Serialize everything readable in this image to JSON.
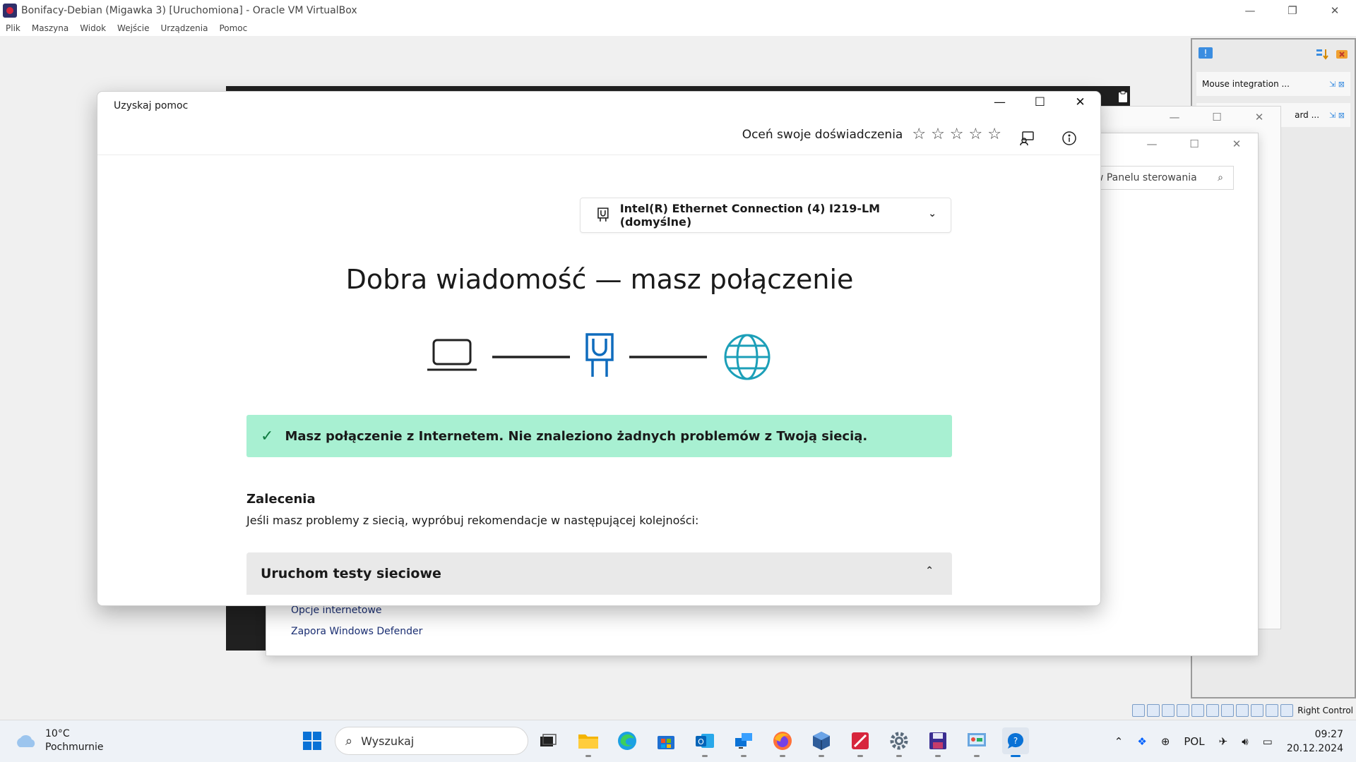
{
  "vbox": {
    "title": "Bonifacy-Debian (Migawka 3) [Uruchomiona] - Oracle VM VirtualBox",
    "menu": [
      "Plik",
      "Maszyna",
      "Widok",
      "Wejście",
      "Urządzenia",
      "Pomoc"
    ],
    "status_right": "Right Control"
  },
  "notifications": {
    "items": [
      "Mouse integration ...",
      "ard ..."
    ]
  },
  "control_panel": {
    "search_placeholder": "aj w Panelu sterowania",
    "links": [
      "Opcje internetowe",
      "Zapora Windows Defender"
    ]
  },
  "help": {
    "title": "Uzyskaj pomoc",
    "rate_label": "Oceń swoje doświadczenia",
    "rating": 0,
    "rating_max": 5,
    "adapter": "Intel(R) Ethernet Connection (4) I219-LM (domyślne)",
    "headline": "Dobra wiadomość — masz połączenie",
    "success_message": "Masz połączenie z Internetem. Nie znaleziono żadnych problemów z Twoją siecią.",
    "recommendations_title": "Zalecenia",
    "recommendations_sub": "Jeśli masz problemy z siecią, wypróbuj rekomendacje w następującej kolejności:",
    "accordion_title": "Uruchom testy sieciowe",
    "colors": {
      "success_bg": "#a8f0d2",
      "accent_blue": "#0f6cbd",
      "globe": "#1c9fb8"
    }
  },
  "taskbar": {
    "temperature": "10°C",
    "weather": "Pochmurnie",
    "search_placeholder": "Wyszukaj",
    "language": "POL",
    "time": "09:27",
    "date": "20.12.2024"
  }
}
